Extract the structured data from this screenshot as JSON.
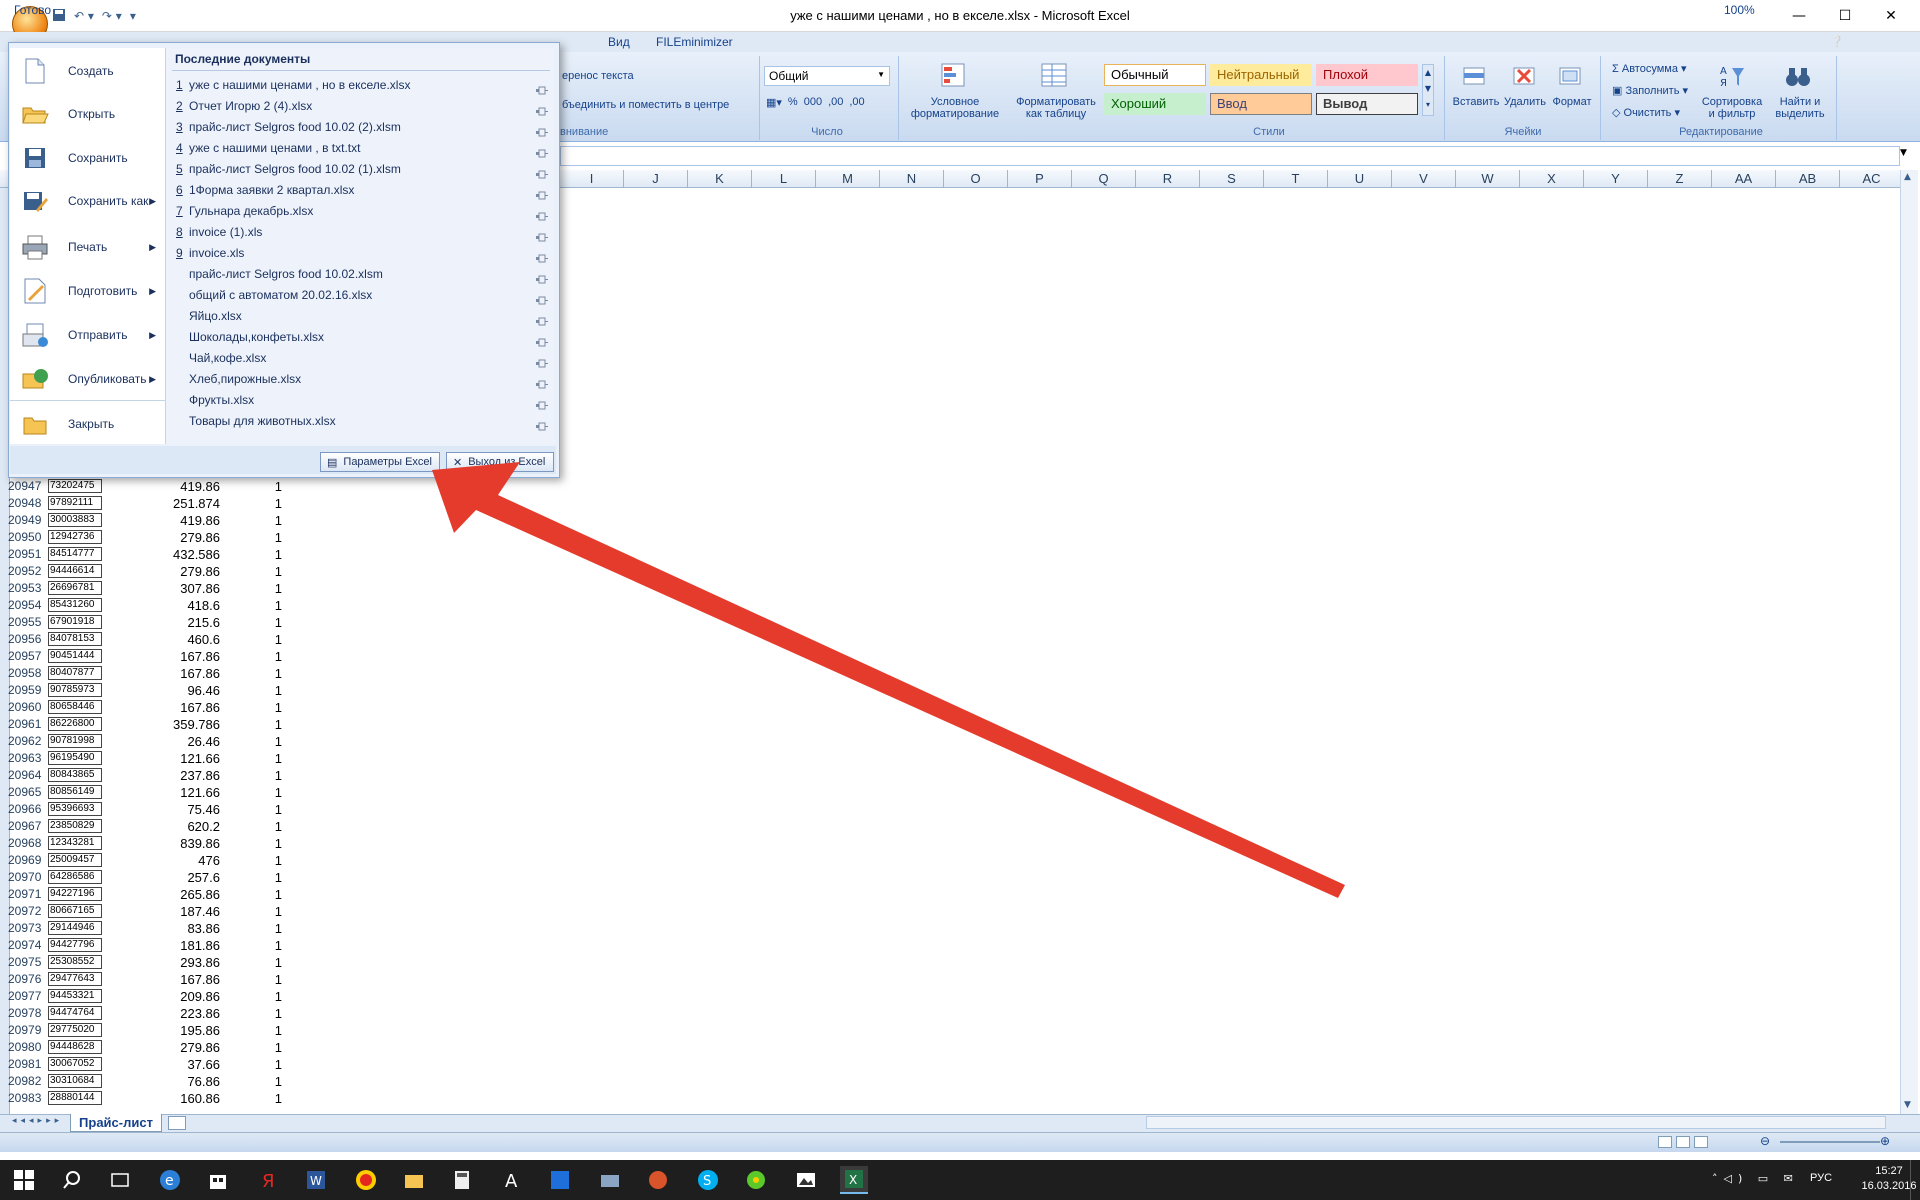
{
  "window": {
    "title": "уже с нашими ценами , но в екселе.xlsx - Microsoft Excel",
    "minimize": "—",
    "maximize": "☐",
    "close": "✕"
  },
  "ribbon": {
    "tabs": [
      "Вид",
      "FILEminimizer"
    ],
    "alignment_items": [
      "еренос текста",
      "бъединить и поместить в центре"
    ],
    "alignment_group": "внивание",
    "number_format": "Общий",
    "number_group": "Число",
    "number_buttons": [
      "%",
      "000",
      ",00",
      ",00"
    ],
    "cond_format": [
      "Условное",
      "форматирование"
    ],
    "table_format": [
      "Форматировать",
      "как таблицу"
    ],
    "styles": {
      "normal": "Обычный",
      "neutral": "Нейтральный",
      "bad": "Плохой",
      "good": "Хороший",
      "input": "Ввод",
      "output": "Вывод"
    },
    "styles_group": "Стили",
    "cells_buttons": [
      "Вставить",
      "Удалить",
      "Формат"
    ],
    "cells_group": "Ячейки",
    "edit_items": [
      "Автосумма",
      "Заполнить",
      "Очистить"
    ],
    "sort_filter": [
      "Сортировка",
      "и фильтр"
    ],
    "find_select": [
      "Найти и",
      "выделить"
    ],
    "edit_group": "Редактирование"
  },
  "columns": [
    "I",
    "J",
    "K",
    "L",
    "M",
    "N",
    "O",
    "P",
    "Q",
    "R",
    "S",
    "T",
    "U",
    "V",
    "W",
    "X",
    "Y",
    "Z",
    "AA",
    "AB",
    "AC"
  ],
  "rows": [
    {
      "num": "20947",
      "code": "73202475",
      "price": "419.86",
      "qty": "1"
    },
    {
      "num": "20948",
      "code": "97892111",
      "price": "251.874",
      "qty": "1"
    },
    {
      "num": "20949",
      "code": "30003883",
      "price": "419.86",
      "qty": "1"
    },
    {
      "num": "20950",
      "code": "12942736",
      "price": "279.86",
      "qty": "1"
    },
    {
      "num": "20951",
      "code": "84514777",
      "price": "432.586",
      "qty": "1"
    },
    {
      "num": "20952",
      "code": "94446614",
      "price": "279.86",
      "qty": "1"
    },
    {
      "num": "20953",
      "code": "26696781",
      "price": "307.86",
      "qty": "1"
    },
    {
      "num": "20954",
      "code": "85431260",
      "price": "418.6",
      "qty": "1"
    },
    {
      "num": "20955",
      "code": "67901918",
      "price": "215.6",
      "qty": "1"
    },
    {
      "num": "20956",
      "code": "84078153",
      "price": "460.6",
      "qty": "1"
    },
    {
      "num": "20957",
      "code": "90451444",
      "price": "167.86",
      "qty": "1"
    },
    {
      "num": "20958",
      "code": "80407877",
      "price": "167.86",
      "qty": "1"
    },
    {
      "num": "20959",
      "code": "90785973",
      "price": "96.46",
      "qty": "1"
    },
    {
      "num": "20960",
      "code": "80658446",
      "price": "167.86",
      "qty": "1"
    },
    {
      "num": "20961",
      "code": "86226800",
      "price": "359.786",
      "qty": "1"
    },
    {
      "num": "20962",
      "code": "90781998",
      "price": "26.46",
      "qty": "1"
    },
    {
      "num": "20963",
      "code": "96195490",
      "price": "121.66",
      "qty": "1"
    },
    {
      "num": "20964",
      "code": "80843865",
      "price": "237.86",
      "qty": "1"
    },
    {
      "num": "20965",
      "code": "80856149",
      "price": "121.66",
      "qty": "1"
    },
    {
      "num": "20966",
      "code": "95396693",
      "price": "75.46",
      "qty": "1"
    },
    {
      "num": "20967",
      "code": "23850829",
      "price": "620.2",
      "qty": "1"
    },
    {
      "num": "20968",
      "code": "12343281",
      "price": "839.86",
      "qty": "1"
    },
    {
      "num": "20969",
      "code": "25009457",
      "price": "476",
      "qty": "1"
    },
    {
      "num": "20970",
      "code": "64286586",
      "price": "257.6",
      "qty": "1"
    },
    {
      "num": "20971",
      "code": "94227196",
      "price": "265.86",
      "qty": "1"
    },
    {
      "num": "20972",
      "code": "80667165",
      "price": "187.46",
      "qty": "1"
    },
    {
      "num": "20973",
      "code": "29144946",
      "price": "83.86",
      "qty": "1"
    },
    {
      "num": "20974",
      "code": "94427796",
      "price": "181.86",
      "qty": "1"
    },
    {
      "num": "20975",
      "code": "25308552",
      "price": "293.86",
      "qty": "1"
    },
    {
      "num": "20976",
      "code": "29477643",
      "price": "167.86",
      "qty": "1"
    },
    {
      "num": "20977",
      "code": "94453321",
      "price": "209.86",
      "qty": "1"
    },
    {
      "num": "20978",
      "code": "94474764",
      "price": "223.86",
      "qty": "1"
    },
    {
      "num": "20979",
      "code": "29775020",
      "price": "195.86",
      "qty": "1"
    },
    {
      "num": "20980",
      "code": "94448628",
      "price": "279.86",
      "qty": "1"
    },
    {
      "num": "20981",
      "code": "30067052",
      "price": "37.66",
      "qty": "1"
    },
    {
      "num": "20982",
      "code": "30310684",
      "price": "76.86",
      "qty": "1"
    },
    {
      "num": "20983",
      "code": "28880144",
      "price": "160.86",
      "qty": "1"
    }
  ],
  "office_menu": {
    "items": [
      {
        "label": "Создать",
        "icon": "new-document-icon",
        "arrow": false
      },
      {
        "label": "Открыть",
        "icon": "open-folder-icon",
        "arrow": false
      },
      {
        "label": "Сохранить",
        "icon": "save-icon",
        "arrow": false
      },
      {
        "label": "Сохранить как",
        "icon": "save-as-icon",
        "arrow": true
      },
      {
        "label": "Печать",
        "icon": "printer-icon",
        "arrow": true
      },
      {
        "label": "Подготовить",
        "icon": "prepare-icon",
        "arrow": true
      },
      {
        "label": "Отправить",
        "icon": "send-icon",
        "arrow": true
      },
      {
        "label": "Опубликовать",
        "icon": "publish-icon",
        "arrow": true
      },
      {
        "label": "Закрыть",
        "icon": "close-folder-icon",
        "arrow": false
      }
    ],
    "recent_title": "Последние документы",
    "recent": [
      {
        "num": "1",
        "name": "уже с нашими ценами , но в екселе.xlsx"
      },
      {
        "num": "2",
        "name": "Отчет Игорю 2 (4).xlsx"
      },
      {
        "num": "3",
        "name": "прайс-лист Selgros food 10.02 (2).xlsm"
      },
      {
        "num": "4",
        "name": "уже с нашими ценами ,  в txt.txt"
      },
      {
        "num": "5",
        "name": "прайс-лист Selgros food 10.02 (1).xlsm"
      },
      {
        "num": "6",
        "name": "1Форма заявки 2 квартал.xlsx"
      },
      {
        "num": "7",
        "name": "Гульнара декабрь.xlsx"
      },
      {
        "num": "8",
        "name": "invoice (1).xls"
      },
      {
        "num": "9",
        "name": "invoice.xls"
      },
      {
        "num": "",
        "name": "прайс-лист Selgros food 10.02.xlsm"
      },
      {
        "num": "",
        "name": "общий с автоматом 20.02.16.xlsx"
      },
      {
        "num": "",
        "name": "Яйцо.xlsx"
      },
      {
        "num": "",
        "name": "Шоколады,конфеты.xlsx"
      },
      {
        "num": "",
        "name": "Чай,кофе.xlsx"
      },
      {
        "num": "",
        "name": "Хлеб,пирожные.xlsx"
      },
      {
        "num": "",
        "name": "Фрукты.xlsx"
      },
      {
        "num": "",
        "name": "Товары для животных.xlsx"
      }
    ],
    "options_button": "Параметры Excel",
    "exit_button": "Выход из Excel"
  },
  "sheet_tab": "Прайс-лист",
  "status": {
    "ready": "Готово",
    "zoom": "100%"
  },
  "taskbar": {
    "lang": "РУС",
    "time": "15:27",
    "date": "16.03.2016",
    "icons": [
      "windows-start-icon",
      "search-icon",
      "task-view-icon",
      "edge-icon",
      "store-icon",
      "yandex-icon",
      "word-icon",
      "yandex-browser-icon",
      "explorer-icon",
      "calculator-icon",
      "acrobat-icon",
      "app-icon",
      "scanner-icon",
      "game-icon",
      "skype-icon",
      "icq-icon",
      "photos-icon",
      "excel-icon"
    ]
  },
  "colors": {
    "ribbon_text": "#15428b",
    "arrow": "#e53b2c",
    "taskbar": "#1e1e1e"
  }
}
